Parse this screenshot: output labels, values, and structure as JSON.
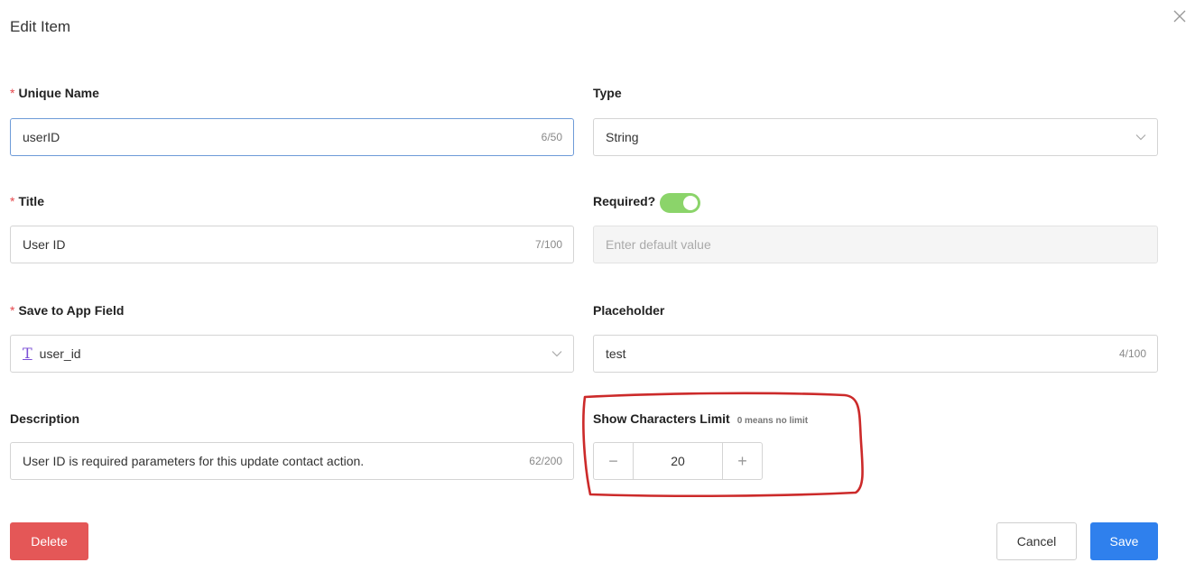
{
  "dialog": {
    "title": "Edit Item"
  },
  "unique_name": {
    "label": "Unique Name",
    "value": "userID",
    "count": "6/50",
    "required_mark": "*"
  },
  "type": {
    "label": "Type",
    "value": "String"
  },
  "title_field": {
    "label": "Title",
    "value": "User ID",
    "count": "7/100",
    "required_mark": "*"
  },
  "required": {
    "label": "Required?",
    "enabled": true,
    "default_placeholder": "Enter default value"
  },
  "save_to_app_field": {
    "label": "Save to App Field",
    "value": "user_id",
    "icon": "text-type-icon",
    "required_mark": "*"
  },
  "placeholder": {
    "label": "Placeholder",
    "value": "test",
    "count": "4/100"
  },
  "description": {
    "label": "Description",
    "value": "User ID is required parameters for this update contact action.",
    "count": "62/200"
  },
  "char_limit": {
    "label": "Show Characters Limit",
    "hint": "0 means no limit",
    "value": "20",
    "minus": "−",
    "plus": "+"
  },
  "actions": {
    "delete": "Delete",
    "cancel": "Cancel",
    "save": "Save"
  },
  "colors": {
    "toggle_on": "#8bd46a",
    "delete": "#e45757",
    "save": "#2f80ed",
    "annotation": "#cc2a2a"
  }
}
